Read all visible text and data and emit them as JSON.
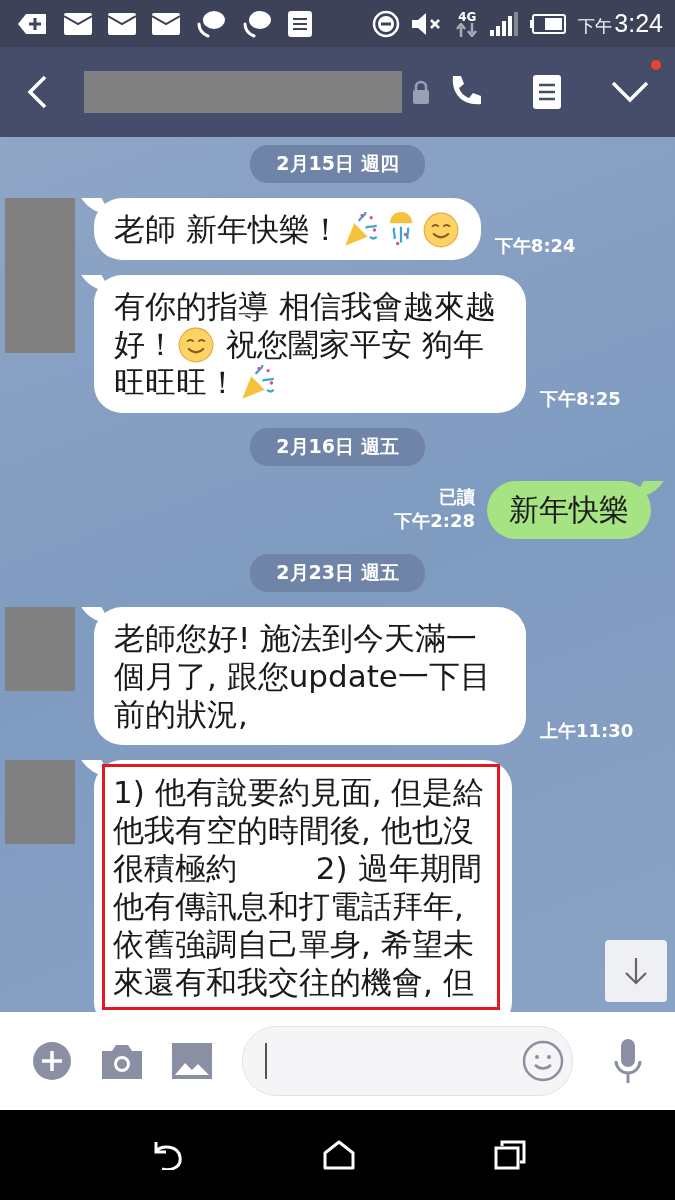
{
  "status_bar": {
    "time_period": "下午",
    "time": "3:24",
    "network": "4G"
  },
  "header": {
    "contact_name_redacted": true,
    "has_notification": true
  },
  "messages": [
    {
      "kind": "date",
      "text": "2月15日 週四"
    },
    {
      "kind": "incoming",
      "avatar": true,
      "time": "下午8:24",
      "parts": [
        {
          "kind": "text",
          "text": "老師 新年快樂！"
        },
        {
          "kind": "popper"
        },
        {
          "kind": "confetti"
        },
        {
          "kind": "smile"
        }
      ]
    },
    {
      "kind": "incoming",
      "avatar": false,
      "time": "下午8:25",
      "parts": [
        {
          "kind": "text",
          "text": "有你的指導 相信我會越來越好！"
        },
        {
          "kind": "smile"
        },
        {
          "kind": "text",
          "text": " 祝您闔家平安 狗年旺旺旺！"
        },
        {
          "kind": "popper"
        }
      ]
    },
    {
      "kind": "date",
      "text": "2月16日 週五"
    },
    {
      "kind": "outgoing",
      "read": "已讀",
      "time": "下午2:28",
      "parts": [
        {
          "kind": "text",
          "text": "新年快樂"
        }
      ]
    },
    {
      "kind": "date",
      "text": "2月23日 週五"
    },
    {
      "kind": "incoming",
      "avatar": true,
      "time": "上午11:30",
      "parts": [
        {
          "kind": "text",
          "text": "老師您好! 施法到今天滿一個月了, 跟您update一下目前的狀況,"
        }
      ]
    },
    {
      "kind": "incoming",
      "avatar": true,
      "highlight": true,
      "parts": [
        {
          "kind": "text",
          "text": "1) 他有說要約見面, 但是給他我有空的時間後, 他也沒很積極約        2) 過年期間他有傳訊息和打電話拜年, 依舊強調自己單身, 希望未來還有和我交往的機會, 但"
        }
      ]
    }
  ],
  "input": {
    "placeholder_cursor": true
  }
}
